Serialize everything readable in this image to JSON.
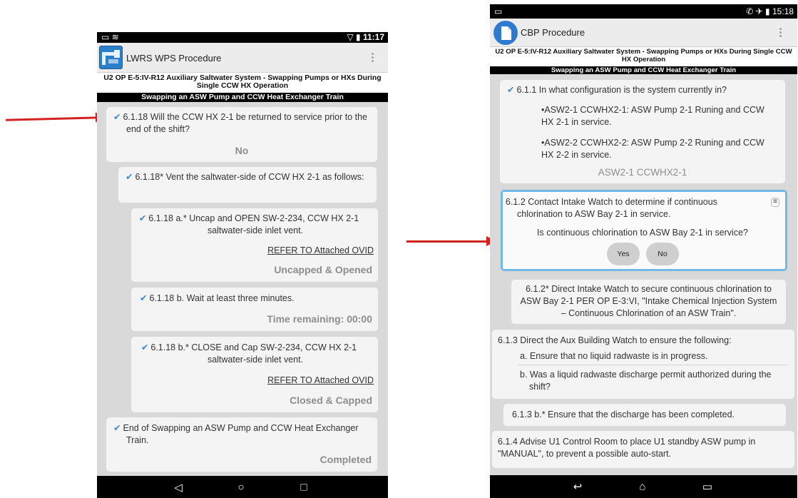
{
  "colors": {
    "arrow": "#d32222",
    "check": "#3f86d4",
    "highlight": "#73b9e6"
  },
  "left": {
    "status_time": "11:17",
    "status_left": "▭ ≋",
    "status_right": "▽ ▮",
    "app_title": "LWRS WPS Procedure",
    "menu_icon": "⋮",
    "procedure_title": "U2 OP E-5:IV-R12 Auxiliary Saltwater System - Swapping Pumps or HXs During Single CCW HX Operation",
    "section_title": "Swapping an ASW Pump and CCW Heat Exchanger Train",
    "steps": {
      "s1": {
        "text": "6.1.18 Will the CCW HX 2-1 be returned to service prior to the end of the shift?",
        "result": "No"
      },
      "s2": {
        "text": "6.1.18* Vent the saltwater-side of CCW HX 2-1 as follows:"
      },
      "s3": {
        "text": "6.1.18 a.* Uncap and OPEN SW-2-234, CCW HX 2-1 saltwater-side inlet vent.",
        "link": "REFER TO Attached OVID",
        "result": "Uncapped & Opened"
      },
      "s4": {
        "text": "6.1.18 b. Wait at least three minutes.",
        "result": "Time remaining: 00:00"
      },
      "s5": {
        "text": "6.1.18 b.* CLOSE and Cap SW-2-234, CCW HX 2-1 saltwater-side inlet vent.",
        "link": "REFER TO Attached OVID",
        "result": "Closed & Capped"
      },
      "s6": {
        "text": "End of Swapping an ASW Pump and CCW Heat Exchanger Train.",
        "result": "Completed"
      }
    },
    "nav": {
      "back": "◁",
      "home": "○",
      "recents": "□"
    }
  },
  "right": {
    "status_time": "15:18",
    "status_left": "▭",
    "status_right": "✆ ✈ ▮",
    "app_title": "CBP Procedure",
    "menu_icon": "⋮",
    "procedure_title": "U2 OP E-5:IV-R12 Auxiliary Saltwater System - Swapping Pumps or HXs During Single CCW HX Operation",
    "section_title": "Swapping an ASW Pump and CCW Heat Exchanger Train",
    "steps": {
      "s1": {
        "text": "6.1.1 In what configuration is the system currently in?",
        "opt1": "•ASW2-1 CCWHX2-1: ASW Pump 2-1 Runing and CCW HX 2-1 in service.",
        "opt2": "•ASW2-2 CCWHX2-2: ASW Pump 2-2 Runing and CCW HX 2-2 in service.",
        "result": "ASW2-1 CCWHX2-1"
      },
      "s2": {
        "text": "6.1.2 Contact Intake Watch to determine if continuous chlorination to ASW Bay 2-1 in service.",
        "question": "Is continuous chlorination to ASW Bay 2-1 in service?",
        "yes": "Yes",
        "no": "No"
      },
      "s3": {
        "text": "6.1.2* Direct Intake Watch to secure continuous chlorination to ASW Bay 2-1 PER OP E-3:VI, \"Intake Chemical Injection System – Continuous Chlorination of an ASW Train\"."
      },
      "s4": {
        "text": "6.1.3 Direct the Aux Building Watch to ensure the following:",
        "a": "a. Ensure that no liquid radwaste is in progress.",
        "b": "b. Was a liquid radwaste discharge permit authorized during the shift?"
      },
      "s5": {
        "text": "6.1.3 b.* Ensure that the discharge has been completed."
      },
      "s6": {
        "text": "6.1.4 Advise U1 Control Room to place U1 standby ASW pump in \"MANUAL\", to prevent a possible auto-start."
      }
    },
    "nav": {
      "back": "↩",
      "home": "⌂",
      "recents": "▭"
    }
  }
}
